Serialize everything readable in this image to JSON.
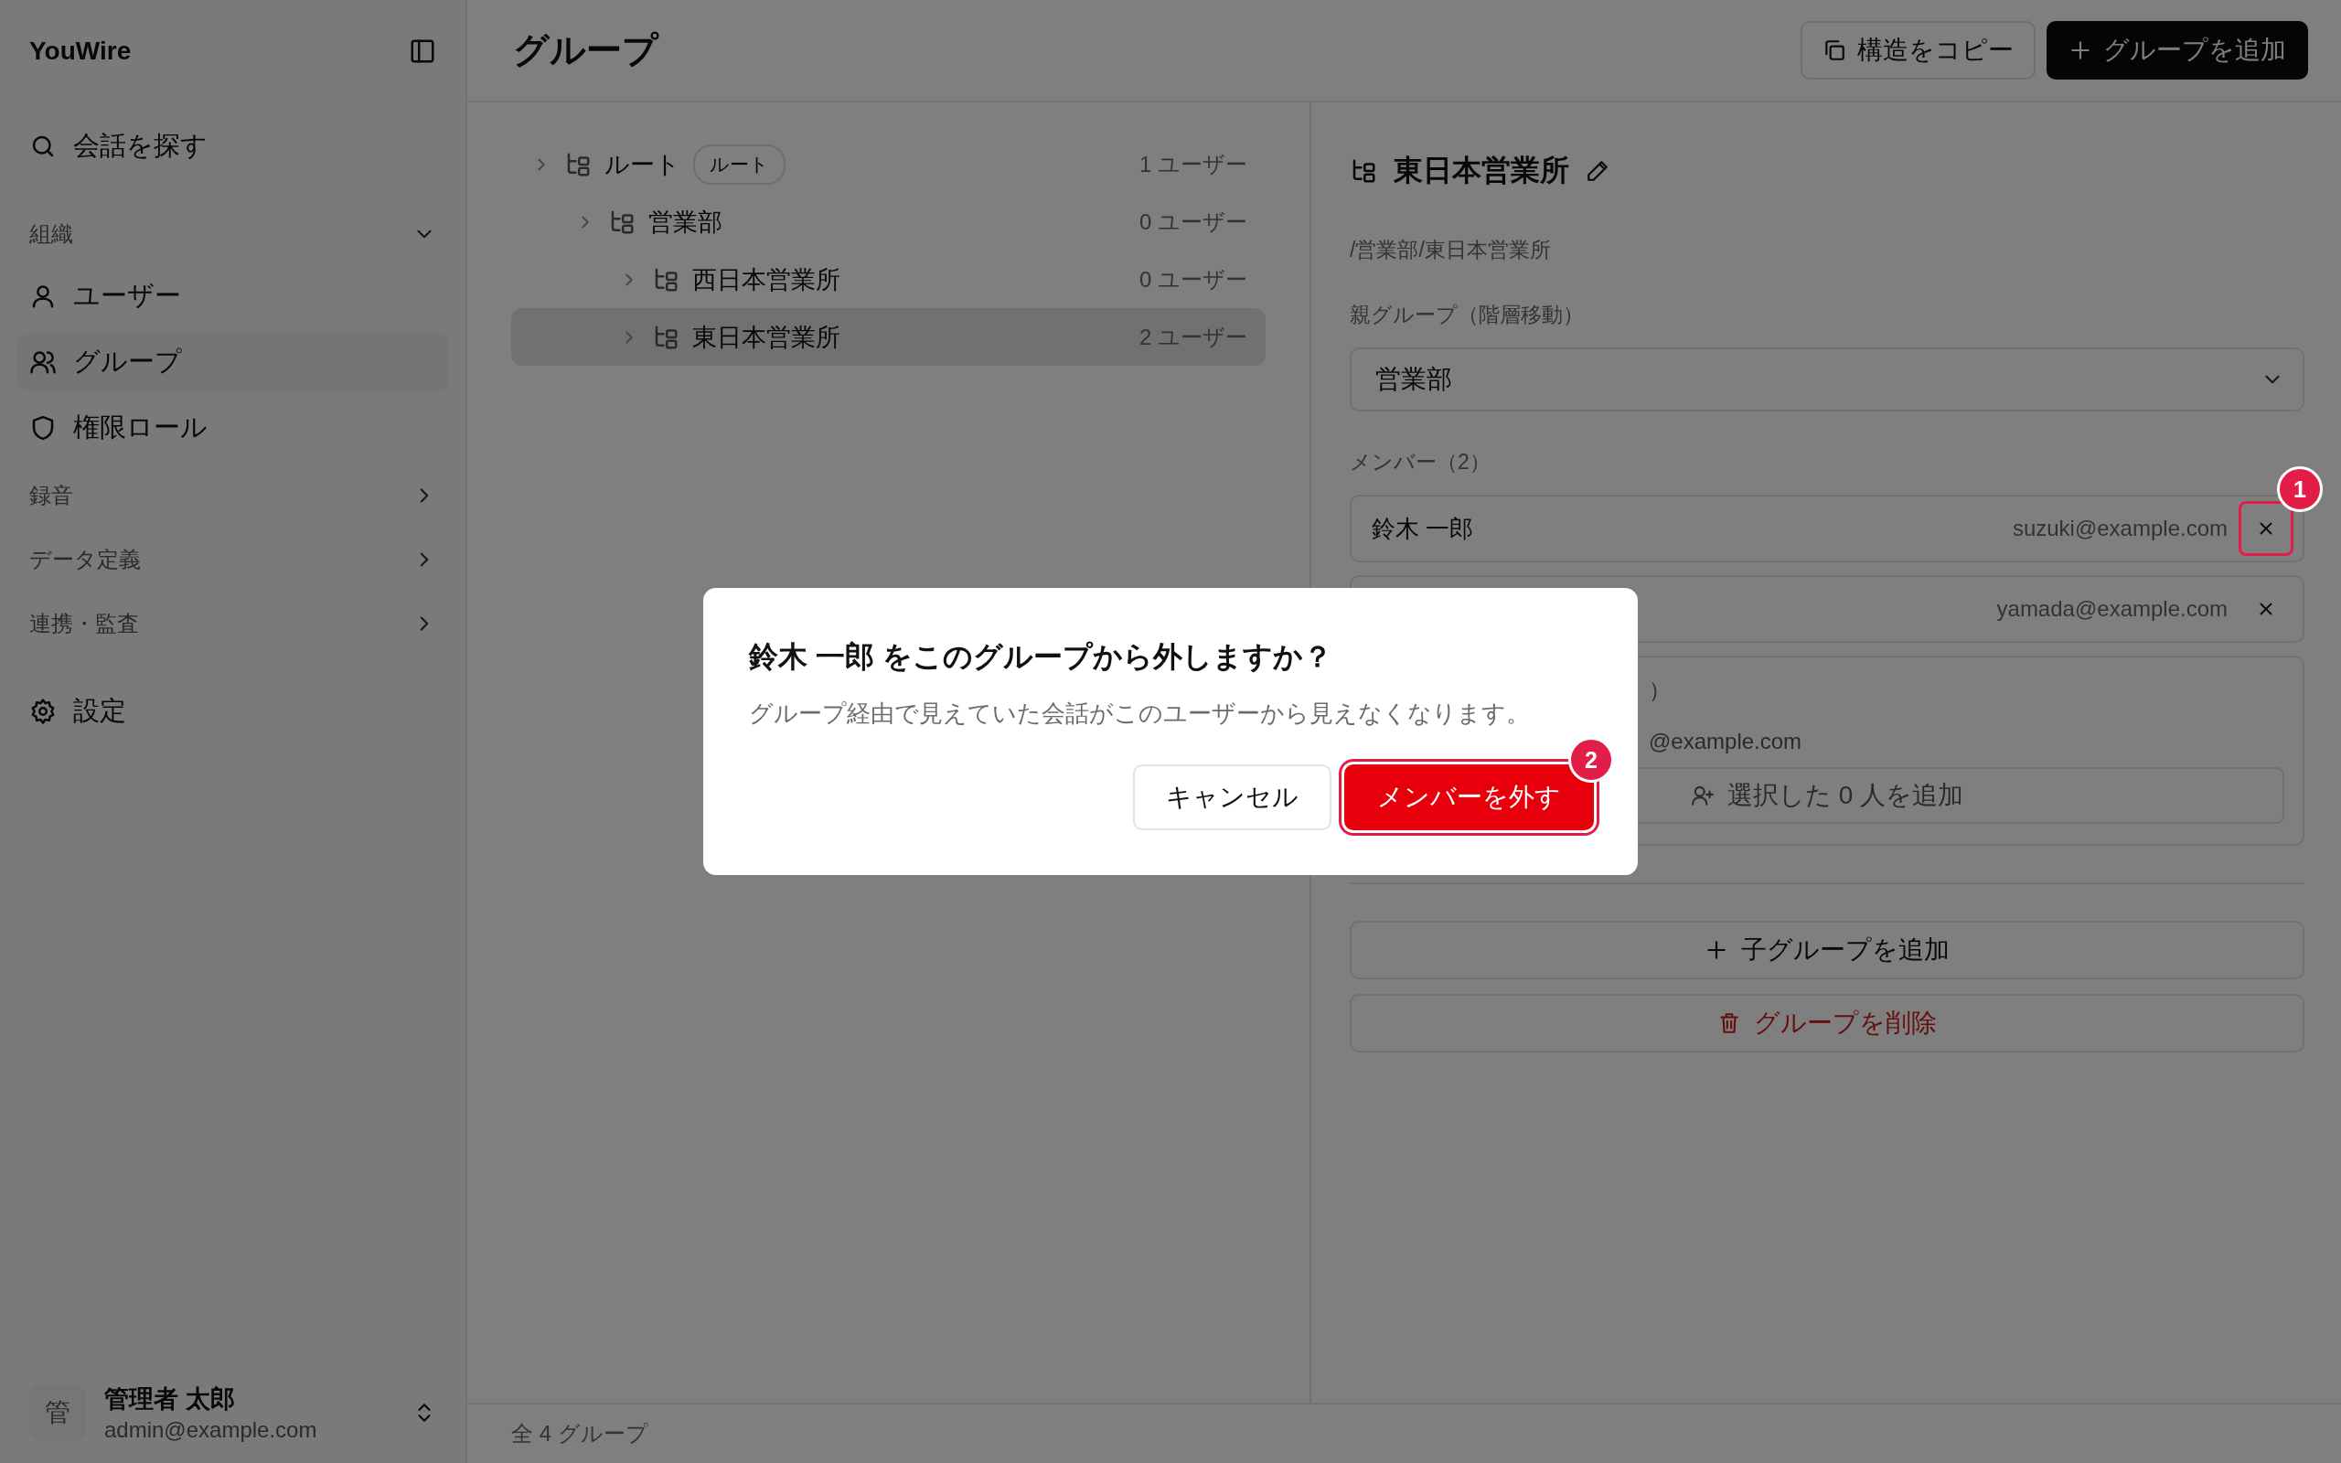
{
  "sidebar": {
    "logo": "YouWire",
    "search": "会話を探す",
    "sections": [
      {
        "label": "組織",
        "expanded": true,
        "items": [
          {
            "label": "ユーザー",
            "selected": false
          },
          {
            "label": "グループ",
            "selected": true
          },
          {
            "label": "権限ロール",
            "selected": false
          }
        ]
      },
      {
        "label": "録音",
        "expanded": false
      },
      {
        "label": "データ定義",
        "expanded": false
      },
      {
        "label": "連携・監査",
        "expanded": false
      }
    ],
    "settings": "設定",
    "account": {
      "avatar": "管",
      "name": "管理者 太郎",
      "email": "admin@example.com"
    }
  },
  "header": {
    "title": "グループ",
    "buttons": [
      {
        "label": "構造をコピー",
        "kind": "outline"
      },
      {
        "label": "グループを追加",
        "kind": "primary"
      }
    ]
  },
  "tree": [
    {
      "name": "ルート",
      "badge": "ルート",
      "count": "1 ユーザー",
      "selected": false,
      "children": [
        {
          "name": "営業部",
          "count": "0 ユーザー",
          "selected": false,
          "children": [
            {
              "name": "西日本営業所",
              "count": "0 ユーザー",
              "selected": false
            },
            {
              "name": "東日本営業所",
              "count": "2 ユーザー",
              "selected": true
            }
          ]
        }
      ]
    }
  ],
  "detail": {
    "title": "東日本営業所",
    "path": "/営業部/東日本営業所",
    "parent_label": "親グループ（階層移動）",
    "parent_value": "営業部",
    "members_label": "メンバー（2）",
    "members": [
      {
        "name": "鈴木 一郎",
        "email": "suzuki@example.com",
        "callout": "1"
      },
      {
        "email": "yamada@example.com"
      }
    ],
    "add_section": {
      "label": "）",
      "candidate": "@example.com",
      "button": "選択した 0 人を追加"
    },
    "actions": [
      {
        "label": "子グループを追加",
        "kind": "add"
      },
      {
        "label": "グループを削除",
        "kind": "danger"
      }
    ]
  },
  "status_bar": "全 4 グループ",
  "dialog": {
    "title": "鈴木 一郎 をこのグループから外しますか？",
    "description": "グループ経由で見えていた会話がこのユーザーから見えなくなります。",
    "buttons": [
      {
        "label": "キャンセル",
        "kind": "secondary"
      },
      {
        "label": "メンバーを外す",
        "kind": "danger",
        "callout": "2"
      }
    ]
  }
}
